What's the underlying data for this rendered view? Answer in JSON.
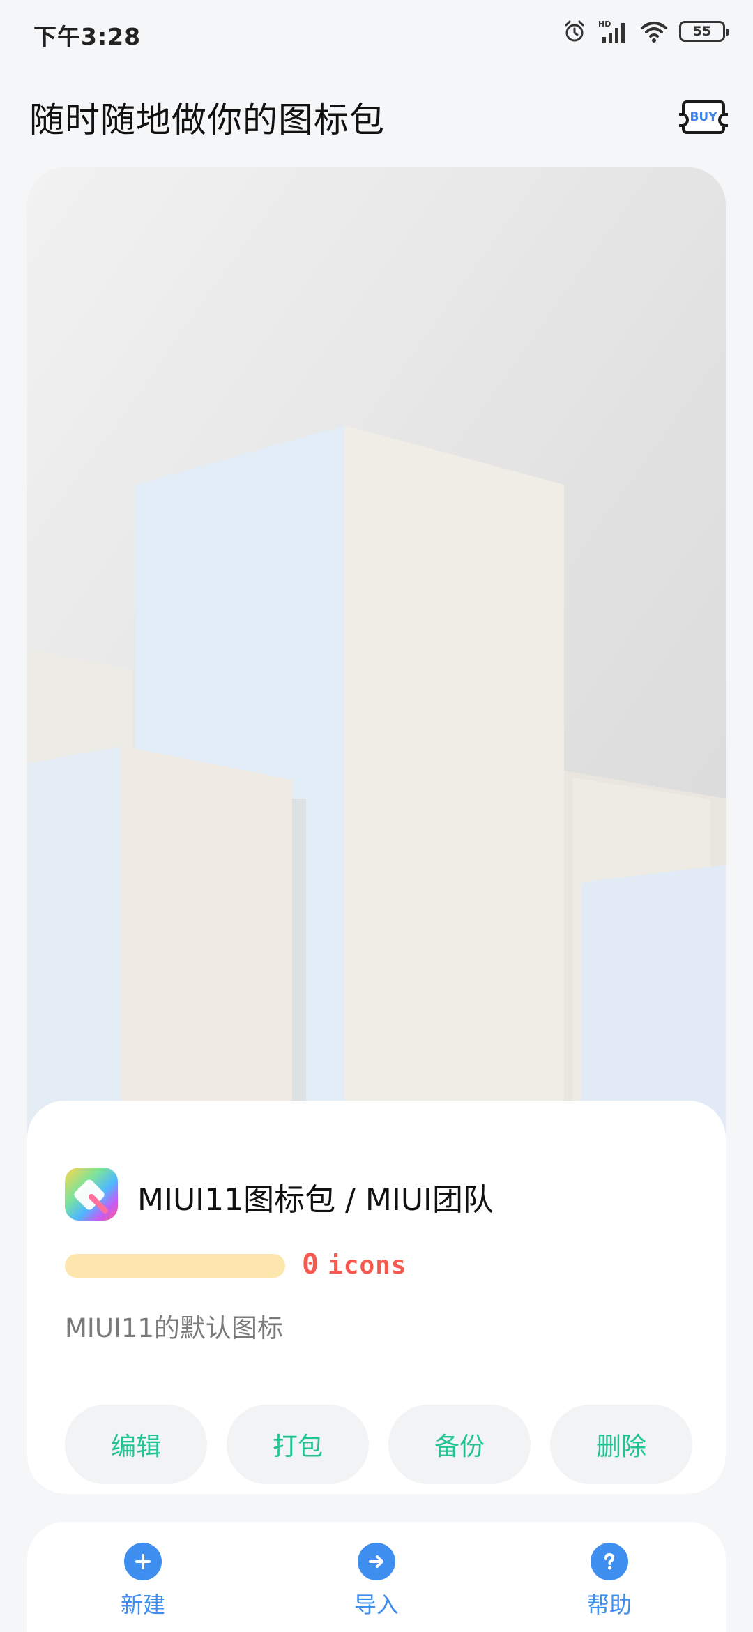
{
  "status_bar": {
    "time": "下午3:28",
    "battery": "55",
    "network_badge": "HD",
    "icons": [
      "alarm-icon",
      "signal-icon",
      "wifi-icon",
      "battery-icon"
    ]
  },
  "header": {
    "title": "随时随地做你的图标包",
    "buy_label": "BUY"
  },
  "pack": {
    "name": "MIUI11图标包 / MIUI团队",
    "count": "0",
    "count_unit": "icons",
    "progress": 0,
    "description": "MIUI11的默认图标"
  },
  "actions": [
    {
      "label": "编辑"
    },
    {
      "label": "打包"
    },
    {
      "label": "备份"
    },
    {
      "label": "删除"
    }
  ],
  "bottom_nav": [
    {
      "label": "新建",
      "icon": "plus-icon"
    },
    {
      "label": "导入",
      "icon": "arrow-right-icon"
    },
    {
      "label": "帮助",
      "icon": "question-icon"
    }
  ],
  "colors": {
    "accent_green": "#21c48e",
    "accent_blue": "#3f8ff0",
    "count_red": "#f45a4f",
    "progress_track": "#fde6ad"
  }
}
